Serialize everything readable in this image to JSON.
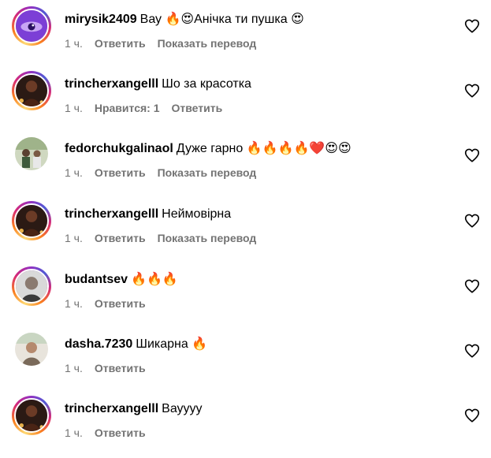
{
  "comments": [
    {
      "username": "mirysik2409",
      "text": "Вау 🔥😍Анічка ти пушка 😍",
      "time": "1 ч.",
      "likes": "",
      "reply": "Ответить",
      "translate": "Показать перевод",
      "avatar": "purple-eye"
    },
    {
      "username": "trincherxangelll",
      "text": "Шо за красотка",
      "time": "1 ч.",
      "likes": "Нравится: 1",
      "reply": "Ответить",
      "translate": "",
      "avatar": "portrait-dark"
    },
    {
      "username": "fedorchukgalinaol",
      "text": "Дуже гарно 🔥🔥🔥🔥❤️😍😍",
      "time": "1 ч.",
      "likes": "",
      "reply": "Ответить",
      "translate": "Показать перевод",
      "avatar": "outdoor-group"
    },
    {
      "username": "trincherxangelll",
      "text": "Неймовірна",
      "time": "1 ч.",
      "likes": "",
      "reply": "Ответить",
      "translate": "Показать перевод",
      "avatar": "portrait-dark"
    },
    {
      "username": "budantsev",
      "text": "🔥🔥🔥",
      "time": "1 ч.",
      "likes": "",
      "reply": "Ответить",
      "translate": "",
      "avatar": "man-grey"
    },
    {
      "username": "dasha.7230",
      "text": "Шикарна 🔥",
      "time": "1 ч.",
      "likes": "",
      "reply": "Ответить",
      "translate": "",
      "avatar": "woman-light"
    },
    {
      "username": "trincherxangelll",
      "text": "Вауууу",
      "time": "1 ч.",
      "likes": "",
      "reply": "Ответить",
      "translate": "",
      "avatar": "portrait-dark"
    }
  ],
  "colors": {
    "text": "#000000",
    "meta": "#737373",
    "ring_start": "#feda75",
    "ring_end": "#962fbf"
  },
  "icons": {
    "like": "heart-outline-icon"
  }
}
